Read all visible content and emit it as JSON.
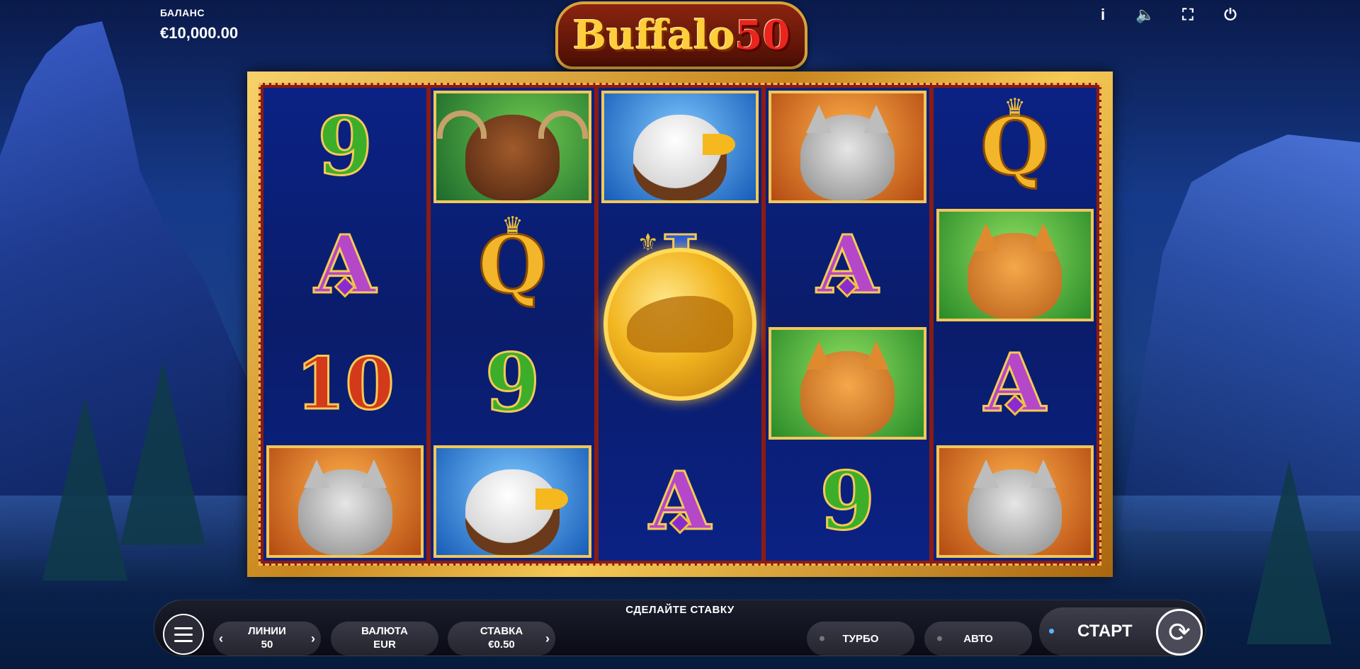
{
  "balance": {
    "label": "БАЛАНС",
    "value": "€10,000.00"
  },
  "logo": {
    "name": "Buffalo",
    "number": "50"
  },
  "top_icons": {
    "info": "i",
    "sound": "🔈",
    "fullscreen": "⛶",
    "power": "⏻"
  },
  "reels": [
    [
      {
        "type": "text",
        "value": "9",
        "cls": "sym-9"
      },
      {
        "type": "text",
        "value": "A",
        "cls": "sym-A"
      },
      {
        "type": "text",
        "value": "10",
        "cls": "sym-10"
      },
      {
        "type": "animal",
        "value": "wolf"
      }
    ],
    [
      {
        "type": "animal",
        "value": "moose"
      },
      {
        "type": "text",
        "value": "Q",
        "cls": "sym-Q"
      },
      {
        "type": "text",
        "value": "9",
        "cls": "sym-9"
      },
      {
        "type": "animal",
        "value": "eagle"
      }
    ],
    [
      {
        "type": "animal",
        "value": "eagle"
      },
      {
        "type": "text",
        "value": "J",
        "cls": "sym-J"
      },
      {
        "type": "coin",
        "value": "buffalo-coin"
      },
      {
        "type": "text",
        "value": "A",
        "cls": "sym-A"
      }
    ],
    [
      {
        "type": "animal",
        "value": "wolf"
      },
      {
        "type": "text",
        "value": "A",
        "cls": "sym-A"
      },
      {
        "type": "animal",
        "value": "puma"
      },
      {
        "type": "text",
        "value": "9",
        "cls": "sym-9"
      }
    ],
    [
      {
        "type": "text",
        "value": "Q",
        "cls": "sym-Q"
      },
      {
        "type": "animal",
        "value": "puma"
      },
      {
        "type": "text",
        "value": "A",
        "cls": "sym-A"
      },
      {
        "type": "animal",
        "value": "wolf"
      }
    ]
  ],
  "controls": {
    "prompt": "СДЕЛАЙТЕ СТАВКУ",
    "lines": {
      "label": "ЛИНИИ",
      "value": "50"
    },
    "currency": {
      "label": "ВАЛЮТА",
      "value": "EUR"
    },
    "bet": {
      "label": "СТАВКА",
      "value": "€0.50"
    },
    "turbo": "ТУРБО",
    "auto": "АВТО",
    "start": "СТАРТ",
    "arrow_left": "‹",
    "arrow_right": "›"
  }
}
